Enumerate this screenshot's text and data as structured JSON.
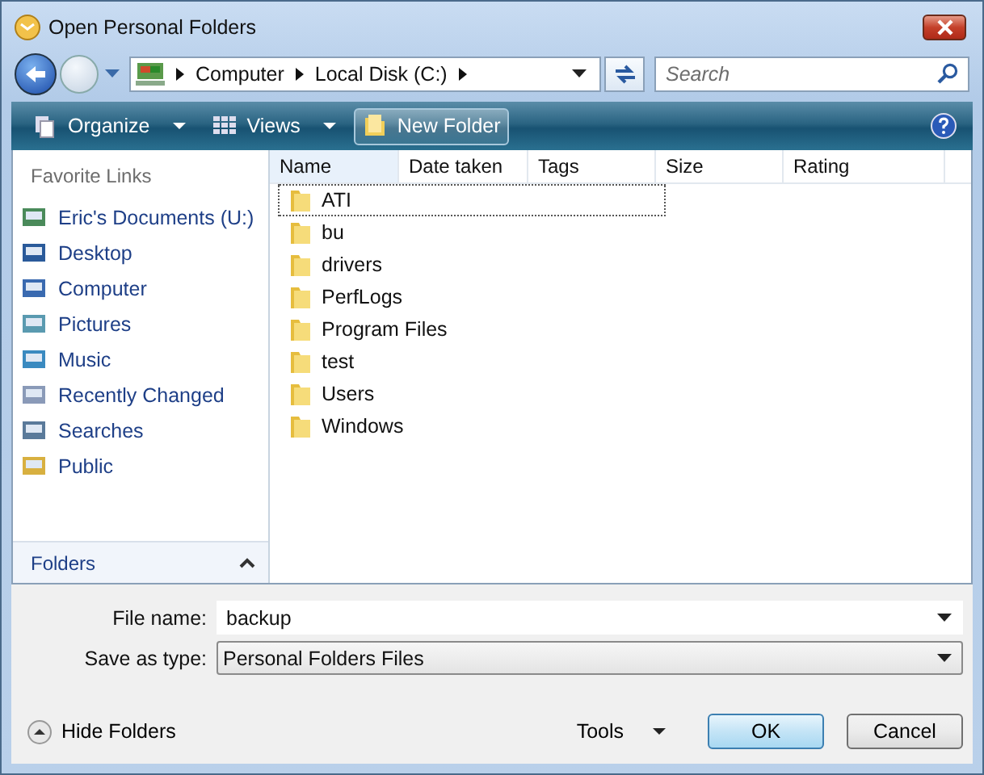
{
  "window": {
    "title": "Open Personal Folders"
  },
  "address": {
    "crumbs": [
      "Computer",
      "Local Disk (C:)"
    ]
  },
  "search": {
    "placeholder": "Search"
  },
  "toolbar": [
    {
      "label": "Organize",
      "kind": "menu"
    },
    {
      "label": "Views",
      "kind": "menu"
    },
    {
      "label": "New Folder",
      "kind": "button"
    }
  ],
  "sidebar": {
    "heading": "Favorite Links",
    "items": [
      "Eric's Documents (U:)",
      "Desktop",
      "Computer",
      "Pictures",
      "Music",
      "Recently Changed",
      "Searches",
      "Public"
    ],
    "folders": "Folders"
  },
  "table": {
    "columns": [
      "Name",
      "Date taken",
      "Tags",
      "Size",
      "Rating"
    ],
    "rows": [
      {
        "name": "ATI",
        "selected": true
      },
      {
        "name": "bu",
        "selected": false
      },
      {
        "name": "drivers",
        "selected": false
      },
      {
        "name": "PerfLogs",
        "selected": false
      },
      {
        "name": "Program Files",
        "selected": false
      },
      {
        "name": "test",
        "selected": false
      },
      {
        "name": "Users",
        "selected": false
      },
      {
        "name": "Windows",
        "selected": false
      }
    ]
  },
  "form": {
    "file_name_label": "File name:",
    "file_name": "backup",
    "type_label": "Save as type:",
    "type": "Personal Folders Files"
  },
  "footer": {
    "hide_folders": "Hide Folders",
    "tools": "Tools",
    "buttons": [
      "OK",
      "Cancel"
    ]
  }
}
